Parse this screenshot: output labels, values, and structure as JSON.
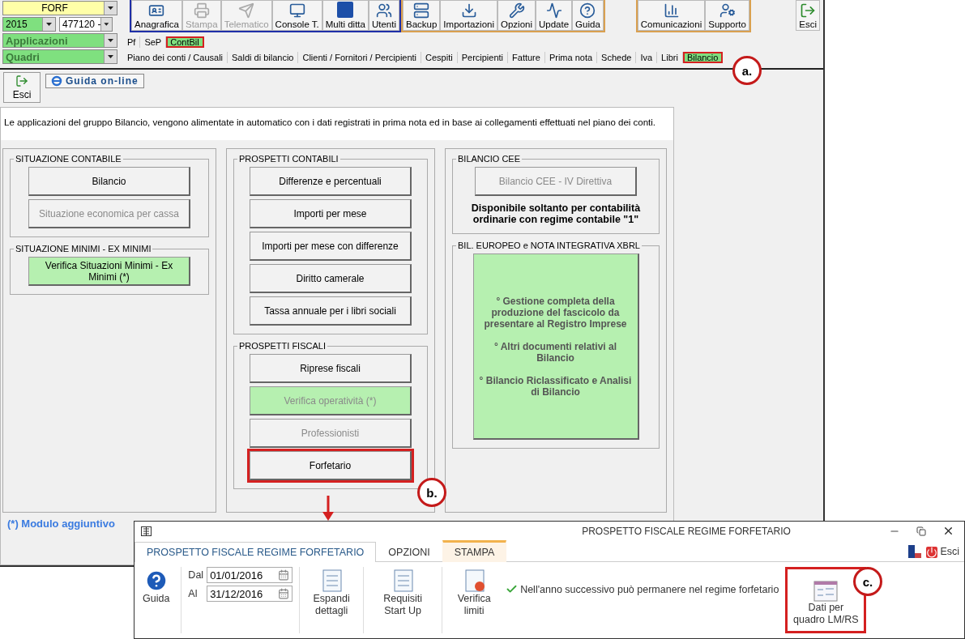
{
  "selectors": {
    "company": "FORF",
    "year": "2015",
    "code": "477120 -",
    "applications": "Applicazioni",
    "quadri": "Quadri"
  },
  "toolbar_groups": [
    {
      "buttons": [
        {
          "label": "Anagrafica",
          "disabled": false
        },
        {
          "label": "Stampa",
          "disabled": true
        },
        {
          "label": "Telematico",
          "disabled": true
        },
        {
          "label": "Console T.",
          "disabled": false
        },
        {
          "label": "Multi ditta",
          "disabled": false
        },
        {
          "label": "Utenti",
          "disabled": false
        }
      ]
    },
    {
      "buttons": [
        {
          "label": "Backup",
          "disabled": false
        },
        {
          "label": "Importazioni",
          "disabled": false
        },
        {
          "label": "Opzioni",
          "disabled": false
        },
        {
          "label": "Update",
          "disabled": false
        },
        {
          "label": "Guida",
          "disabled": false
        }
      ]
    },
    {
      "buttons": [
        {
          "label": "Comunicazioni",
          "disabled": false
        },
        {
          "label": "Supporto",
          "disabled": false
        }
      ]
    }
  ],
  "exit_button": "Esci",
  "modules": [
    {
      "label": "Pf",
      "selected": false,
      "callout": false
    },
    {
      "label": "SeP",
      "selected": false,
      "callout": false
    },
    {
      "label": "ContBil",
      "selected": true,
      "callout": true
    }
  ],
  "sections": [
    {
      "label": "Piano dei conti / Causali",
      "selected": false,
      "callout": false
    },
    {
      "label": "Saldi di bilancio",
      "selected": false,
      "callout": false
    },
    {
      "label": "Clienti / Fornitori / Percipienti",
      "selected": false,
      "callout": false
    },
    {
      "label": "Cespiti",
      "selected": false,
      "callout": false
    },
    {
      "label": "Percipienti",
      "selected": false,
      "callout": false
    },
    {
      "label": "Fatture",
      "selected": false,
      "callout": false
    },
    {
      "label": "Prima nota",
      "selected": false,
      "callout": false
    },
    {
      "label": "Schede",
      "selected": false,
      "callout": false
    },
    {
      "label": "Iva",
      "selected": false,
      "callout": false
    },
    {
      "label": "Libri",
      "selected": false,
      "callout": false
    },
    {
      "label": "Bilancio",
      "selected": true,
      "callout": true
    }
  ],
  "subtoolbar": {
    "exit": "Esci",
    "help_link": "Guida on-line"
  },
  "description": "Le applicazioni del gruppo Bilancio, vengono alimentate in automatico con i dati registrati in prima nota ed in base ai collegamenti effettuati nel piano dei conti.",
  "columns": [
    {
      "groups": [
        {
          "title": "SITUAZIONE CONTABILE",
          "buttons": [
            {
              "label": "Bilancio",
              "kind": "plain",
              "disabled": false,
              "callout": false
            },
            {
              "label": "Situazione economica per cassa",
              "kind": "plain",
              "disabled": true,
              "callout": false
            }
          ]
        },
        {
          "title": "SITUAZIONE MINIMI - EX MINIMI",
          "buttons": [
            {
              "label": "Verifica Situazioni Minimi - Ex Minimi (*)",
              "kind": "green",
              "disabled": false,
              "callout": false
            }
          ]
        }
      ]
    },
    {
      "groups": [
        {
          "title": "PROSPETTI CONTABILI",
          "buttons": [
            {
              "label": "Differenze e percentuali",
              "kind": "plain",
              "disabled": false,
              "callout": false
            },
            {
              "label": "Importi per mese",
              "kind": "plain",
              "disabled": false,
              "callout": false
            },
            {
              "label": "Importi per mese con differenze",
              "kind": "plain",
              "disabled": false,
              "callout": false
            },
            {
              "label": "Diritto camerale",
              "kind": "plain",
              "disabled": false,
              "callout": false
            },
            {
              "label": "Tassa annuale per i libri sociali",
              "kind": "plain",
              "disabled": false,
              "callout": false
            }
          ]
        },
        {
          "title": "PROSPETTI FISCALI",
          "buttons": [
            {
              "label": "Riprese fiscali",
              "kind": "plain",
              "disabled": false,
              "callout": false
            },
            {
              "label": "Verifica operatività (*)",
              "kind": "green",
              "disabled": true,
              "callout": false
            },
            {
              "label": "Professionisti",
              "kind": "plain",
              "disabled": true,
              "callout": false
            },
            {
              "label": "Forfetario",
              "kind": "plain",
              "disabled": false,
              "callout": true
            }
          ]
        }
      ]
    },
    {
      "groups": [
        {
          "title": "BILANCIO CEE",
          "buttons": [
            {
              "label": "Bilancio CEE - IV Direttiva",
              "kind": "plain",
              "disabled": true,
              "callout": false
            }
          ],
          "note": "Disponibile soltanto per contabilità ordinarie con regime contabile \"1\""
        },
        {
          "title": "BIL. EUROPEO e NOTA INTEGRATIVA XBRL",
          "buttons": [
            {
              "kind": "large",
              "callout": false,
              "lines": [
                "° Gestione completa della produzione del fascicolo da presentare al Registro Imprese",
                "° Altri documenti relativi al Bilancio",
                "° Bilancio Riclassificato e Analisi di Bilancio"
              ]
            }
          ]
        }
      ]
    }
  ],
  "footnote": "(*) Modulo aggiuntivo",
  "dialog": {
    "title": "PROSPETTO FISCALE REGIME FORFETARIO",
    "tabs": [
      {
        "label": "PROSPETTO FISCALE REGIME FORFETARIO",
        "selected": true
      },
      {
        "label": "OPZIONI",
        "selected": false
      },
      {
        "label": "STAMPA",
        "selected": false
      }
    ],
    "exit": "Esci",
    "help": "Guida",
    "from_label": "Dal",
    "from": "01/01/2016",
    "to_label": "Al",
    "to": "31/12/2016",
    "actions": [
      {
        "label": "Espandi dettagli"
      },
      {
        "label": "Requisiti Start Up"
      },
      {
        "label": "Verifica limiti"
      }
    ],
    "message": "Nell'anno successivo può permanere nel regime forfetario",
    "data_button": {
      "label": "Dati per quadro LM/RS",
      "callout": true
    }
  },
  "annotations": [
    "a.",
    "b.",
    "c."
  ]
}
